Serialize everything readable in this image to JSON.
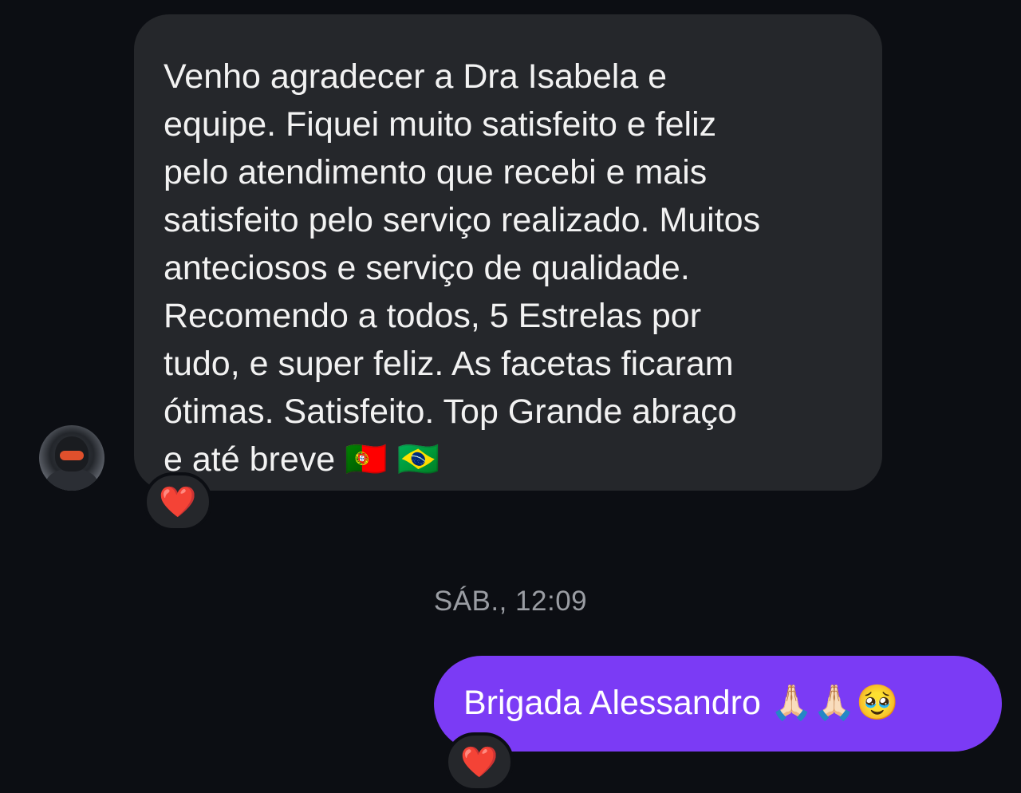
{
  "messages": {
    "incoming": {
      "text": "Venho agradecer a Dra Isabela e\nequipe. Fiquei muito satisfeito e feliz\npelo atendimento que recebi e mais\nsatisfeito pelo serviço realizado. Muitos\nanteciosos e serviço de qualidade.\nRecomendo a todos, 5 Estrelas por\ntudo, e super feliz. As facetas ficaram\nótimas. Satisfeito. Top  Grande abraço\ne até breve 🇵🇹 🇧🇷",
      "reaction": "❤️",
      "avatar_icon": "user-avatar-helmet"
    },
    "timestamp": "SÁB., 12:09",
    "outgoing": {
      "text": "Brigada Alessandro 🙏🏻🙏🏻🥹",
      "reaction": "❤️"
    }
  },
  "colors": {
    "background": "#0c0e13",
    "incoming_bubble": "#25272b",
    "outgoing_bubble": "#7b3bf5",
    "timestamp": "#9a9da3",
    "heart": "#f0323c"
  }
}
